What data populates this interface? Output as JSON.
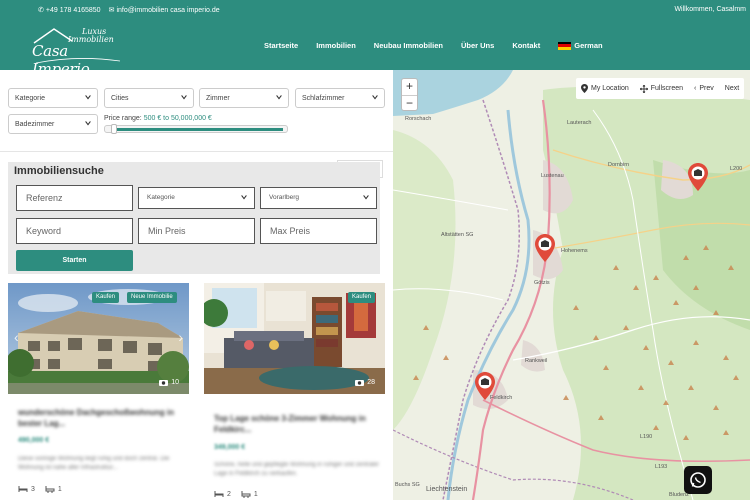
{
  "topbar": {
    "phone": "+49 178 4165850",
    "email": "info@immobilien casa imperio.de",
    "welcome": "Willkommen, Casalmm"
  },
  "logo": {
    "line1": "Luxus",
    "line2": "Immobilien",
    "line3": "Casa Imperio"
  },
  "nav": {
    "items": [
      "Startseite",
      "Immobilien",
      "Neubau Immobilien",
      "Über Uns",
      "Kontakt"
    ],
    "language": "German"
  },
  "filters": {
    "kategorie": "Kategorie",
    "cities": "Cities",
    "zimmer": "Zimmer",
    "schlafzimmer": "Schlafzimmer",
    "badezimmer": "Badezimmer",
    "price_label": "Price range:",
    "price_value": "500 € to 50,000,000 €"
  },
  "search": {
    "title": "Immobiliensuche",
    "referenz": "Referenz",
    "kategorie": "Kategorie",
    "region": "Vorarlberg",
    "keyword": "Keyword",
    "min_preis": "Min Preis",
    "max_preis": "Max Preis",
    "start": "Starten"
  },
  "cards": [
    {
      "badges": [
        "Kaufen",
        "Neue Immobilie"
      ],
      "photos": "10",
      "title": "wunderschöne Dachgeschoßwohnung in bester Lag...",
      "price": "490,000 €",
      "desc": "Diese sonnige Wohnung liegt ruhig und doch zentral. Die Wohnung ist nahe aller Infrastruktur...",
      "beds": "3",
      "baths": "1"
    },
    {
      "badges": [
        "Kaufen"
      ],
      "photos": "28",
      "title": "Top Lage schöne 3-Zimmer Wohnung in Feldkirc...",
      "price": "349,000 €",
      "desc": "Schöne, helle und gepflegte Wohnung in ruhiger und zentraler Lage in Feldkirch zu verkaufen.",
      "beds": "2",
      "baths": "1"
    }
  ],
  "map": {
    "zoom_in": "+",
    "zoom_out": "−",
    "my_location": "My Location",
    "fullscreen": "Fullscreen",
    "prev": "Prev",
    "next": "Next",
    "labels": [
      "Rorschach",
      "Lauterach",
      "Dornbirn",
      "Lustenau",
      "Hohenems",
      "Altstätten SG",
      "Götzis",
      "Rankweil",
      "Feldkirch",
      "Liechtenstein",
      "Buchs SG",
      "Bludenz",
      "L200",
      "L190",
      "L193"
    ]
  },
  "colors": {
    "brand": "#2d8d7f",
    "pin": "#e04a3a"
  }
}
